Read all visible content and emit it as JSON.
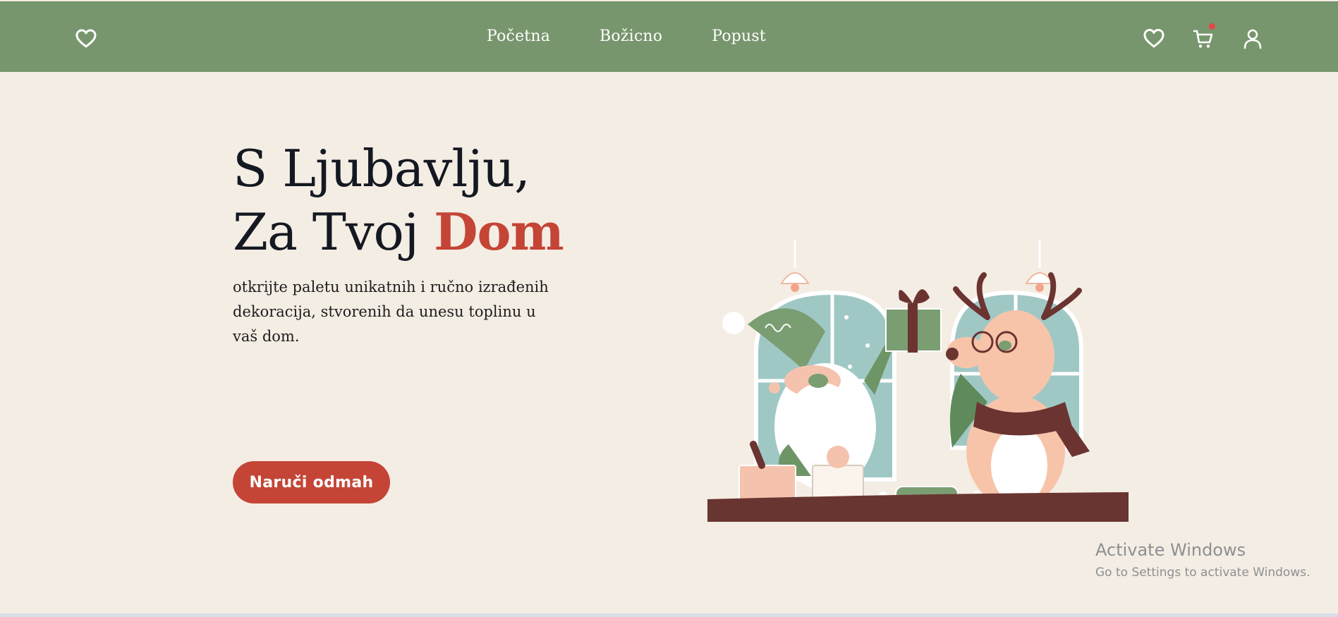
{
  "nav": {
    "logo_icon": "heart-outline-icon",
    "links": [
      {
        "label": "Početna"
      },
      {
        "label": "Božicno"
      },
      {
        "label": "Popust"
      }
    ],
    "icons": [
      "heart-outline-icon",
      "cart-icon",
      "user-icon"
    ],
    "cart_has_notification": true
  },
  "hero": {
    "title_line1": "S Ljubavlju,",
    "title_line2_prefix": "Za Tvoj ",
    "title_accent": "Dom",
    "subtitle": "otkrijte paletu unikatnih i ručno izrađenih dekoracija, stvorenih da unesu toplinu u vaš dom.",
    "cta_label": "Naruči odmah"
  },
  "watermark": {
    "title": "Activate Windows",
    "subtitle": "Go to Settings to activate Windows."
  },
  "colors": {
    "nav_bg": "#77966d",
    "page_bg": "#f4ede4",
    "accent": "#c44536",
    "text": "#141821"
  }
}
